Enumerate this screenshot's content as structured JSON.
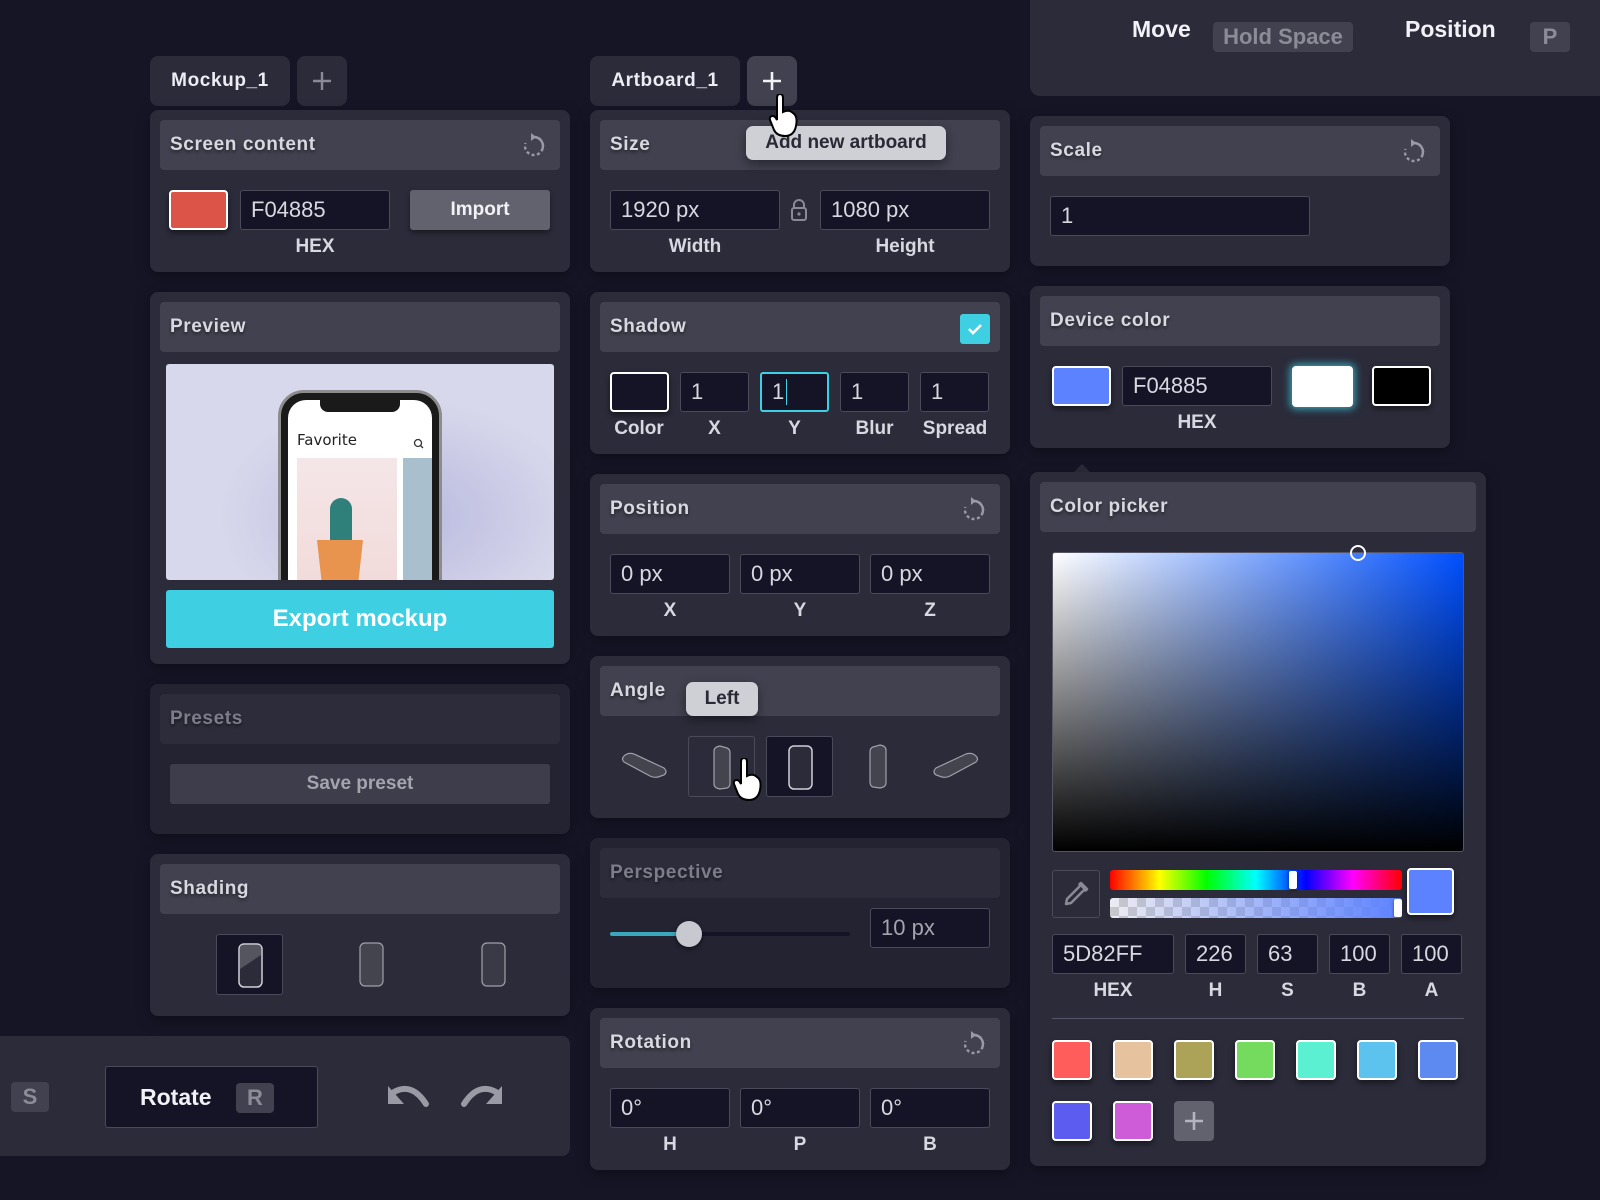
{
  "topbar": {
    "move_label": "Move",
    "move_key": "Hold Space",
    "position_label": "Position",
    "position_key": "P"
  },
  "mockup_tabs": {
    "tab_label": "Mockup_1",
    "add_icon": "plus-icon"
  },
  "artboard_tabs": {
    "tab_label": "Artboard_1",
    "add_icon": "plus-icon",
    "tooltip": "Add new artboard"
  },
  "screen_content": {
    "title": "Screen content",
    "swatch_color": "#DC5447",
    "hex_value": "F04885",
    "hex_label": "HEX",
    "import_label": "Import"
  },
  "preview": {
    "title": "Preview",
    "phone_screen_title": "Favorite",
    "export_label": "Export mockup",
    "accent": "#3ECFE2"
  },
  "presets": {
    "title": "Presets",
    "save_label": "Save preset"
  },
  "shading": {
    "title": "Shading",
    "options": [
      "glossy",
      "soft",
      "flat"
    ],
    "selected": 0
  },
  "bottom_toolbar": {
    "scale_key": "S",
    "rotate_label": "Rotate",
    "rotate_key": "R",
    "undo_icon": "undo-icon",
    "redo_icon": "redo-icon"
  },
  "size": {
    "title": "Size",
    "width_value": "1920 px",
    "width_label": "Width",
    "height_value": "1080 px",
    "height_label": "Height",
    "lock_icon": "lock-icon"
  },
  "shadow": {
    "title": "Shadow",
    "enabled": true,
    "color_label": "Color",
    "color": "#141426",
    "x_value": "1",
    "x_label": "X",
    "y_value": "1",
    "y_label": "Y",
    "blur_value": "1",
    "blur_label": "Blur",
    "spread_value": "1",
    "spread_label": "Spread"
  },
  "position": {
    "title": "Position",
    "x_value": "0 px",
    "x_label": "X",
    "y_value": "0 px",
    "y_label": "Y",
    "z_value": "0 px",
    "z_label": "Z"
  },
  "angle": {
    "title": "Angle",
    "tooltip": "Left",
    "options": [
      "tilt-left",
      "left",
      "front",
      "right",
      "tilt-right"
    ],
    "hovered": 1,
    "selected": 2
  },
  "perspective": {
    "title": "Perspective",
    "slider_fraction": 0.33,
    "value": "10 px"
  },
  "rotation": {
    "title": "Rotation",
    "h_value": "0°",
    "h_label": "H",
    "p_value": "0°",
    "p_label": "P",
    "b_value": "0°",
    "b_label": "B"
  },
  "scale": {
    "title": "Scale",
    "value": "1"
  },
  "device_color": {
    "title": "Device color",
    "swatch_color": "#5D82FF",
    "hex_value": "F04885",
    "hex_label": "HEX",
    "presets": [
      "#FFFFFF",
      "#000000"
    ],
    "selected_preset": 0
  },
  "color_picker": {
    "title": "Color picker",
    "hue_fraction": 0.628,
    "alpha_fraction": 1.0,
    "current_color": "#5D82FF",
    "hex_value": "5D82FF",
    "hex_label": "HEX",
    "h_value": "226",
    "h_label": "H",
    "s_value": "63",
    "s_label": "S",
    "b_value": "100",
    "b_label": "B",
    "a_value": "100",
    "a_label": "A",
    "eyedropper_icon": "eyedropper-icon",
    "swatches": [
      "#FF5C5C",
      "#E6C29E",
      "#ACA358",
      "#75DB5E",
      "#5CF0D2",
      "#5CC3EE",
      "#5C8AF0",
      "#5C5CF0",
      "#CE5CD9"
    ],
    "add_swatch_icon": "plus-icon"
  }
}
